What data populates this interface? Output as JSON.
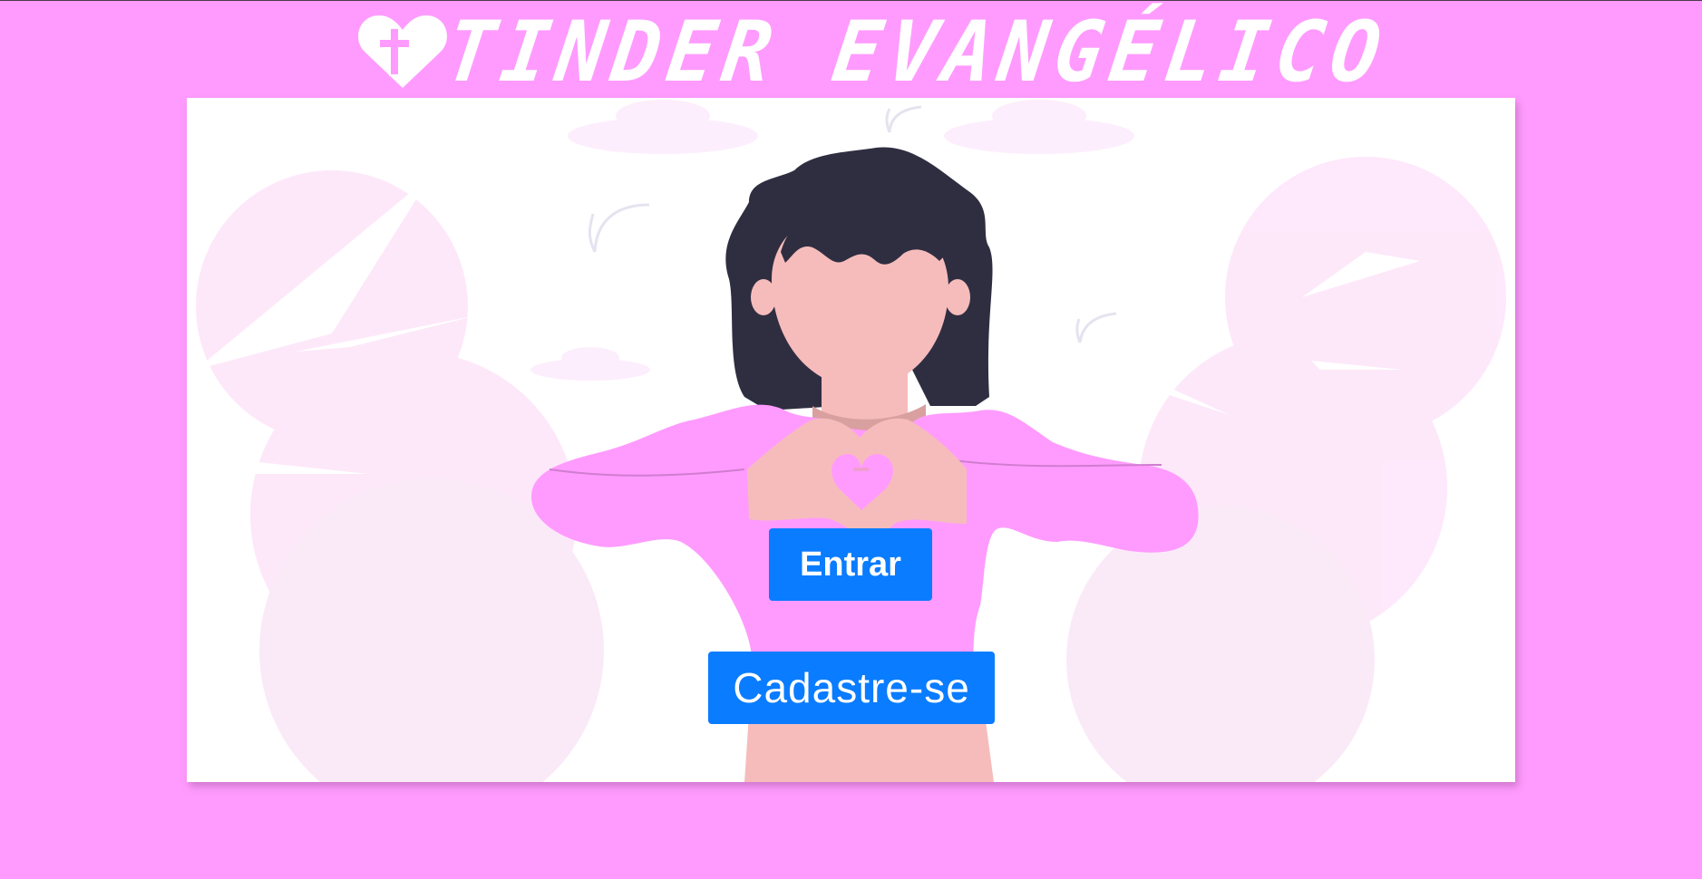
{
  "header": {
    "title": "TINDER EVANGÉLICO",
    "logo_icon": "heart-cross-icon"
  },
  "actions": {
    "login_label": "Entrar",
    "signup_label": "Cadastre-se"
  },
  "illustration": {
    "subject": "woman-heart-hands-illustration"
  },
  "colors": {
    "background": "#ff9bfe",
    "button": "#0a7cff",
    "button_text": "#ffffff",
    "hair": "#2f2e41",
    "skin": "#f6bcbc",
    "shirt": "#ff9bfe"
  }
}
